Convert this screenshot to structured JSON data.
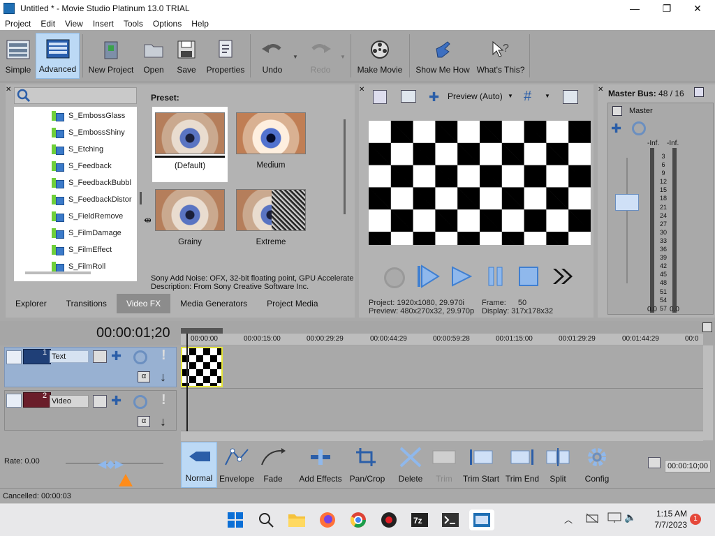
{
  "window": {
    "title": "Untitled * - Movie Studio Platinum 13.0 TRIAL",
    "minimize": "—",
    "maximize": "❐",
    "close": "✕"
  },
  "menu": [
    "Project",
    "Edit",
    "View",
    "Insert",
    "Tools",
    "Options",
    "Help"
  ],
  "toolbar": {
    "simple": "Simple",
    "advanced": "Advanced",
    "new_project": "New Project",
    "open": "Open",
    "save": "Save",
    "properties": "Properties",
    "undo": "Undo",
    "redo": "Redo",
    "make_movie": "Make Movie",
    "show_me_how": "Show Me How",
    "whats_this": "What's This?"
  },
  "explorer": {
    "search_placeholder": "",
    "tree_items": [
      "S_EmbossGlass",
      "S_EmbossShiny",
      "S_Etching",
      "S_Feedback",
      "S_FeedbackBubbl",
      "S_FeedbackDistor",
      "S_FieldRemove",
      "S_FilmDamage",
      "S_FilmEffect",
      "S_FilmRoll"
    ],
    "preset_label": "Preset:",
    "presets": [
      "(Default)",
      "Medium",
      "Grainy",
      "Extreme"
    ],
    "description_line1": "Sony Add Noise: OFX, 32-bit floating point, GPU Accelerate",
    "description_line2": "Description: From Sony Creative Software Inc.",
    "tabs": [
      "Explorer",
      "Transitions",
      "Video FX",
      "Media Generators",
      "Project Media"
    ],
    "active_tab": "Video FX"
  },
  "preview": {
    "mode": "Preview (Auto)",
    "project_label": "Project:",
    "project_value": "1920x1080, 29.970i",
    "preview_label": "Preview:",
    "preview_value": "480x270x32, 29.970p",
    "frame_label": "Frame:",
    "frame_value": "50",
    "display_label": "Display:",
    "display_value": "317x178x32"
  },
  "mixer": {
    "title": "Master Bus:",
    "count": "48 / 16",
    "master_label": "Master",
    "peak_left": "-Inf.",
    "peak_right": "-Inf.",
    "scale": [
      "3",
      "6",
      "9",
      "12",
      "15",
      "18",
      "21",
      "24",
      "27",
      "30",
      "33",
      "36",
      "39",
      "42",
      "45",
      "48",
      "51",
      "54",
      "57"
    ],
    "bottom_left": "0.0",
    "bottom_right": "0.0"
  },
  "timeline": {
    "time": "00:00:01;20",
    "ruler": [
      "00:00:00",
      "00:00:15:00",
      "00:00:29:29",
      "00:00:44:29",
      "00:00:59:28",
      "00:01:15:00",
      "00:01:29:29",
      "00:01:44:29",
      "00:0"
    ],
    "tracks": [
      {
        "num": "1",
        "name": "Text"
      },
      {
        "num": "2",
        "name": "Video"
      }
    ],
    "alpha": "α"
  },
  "edit_toolbar": {
    "rate": "Rate: 0.00",
    "tools": [
      "Normal",
      "Envelope",
      "Fade",
      "Add Effects",
      "Pan/Crop",
      "Delete",
      "Trim",
      "Trim Start",
      "Trim End",
      "Split",
      "Config"
    ],
    "duration": "00:00:10;00"
  },
  "status": {
    "text": "Cancelled: 00:00:03"
  },
  "taskbar": {
    "time": "1:15 AM",
    "date": "7/7/2023",
    "notifications": "1"
  }
}
